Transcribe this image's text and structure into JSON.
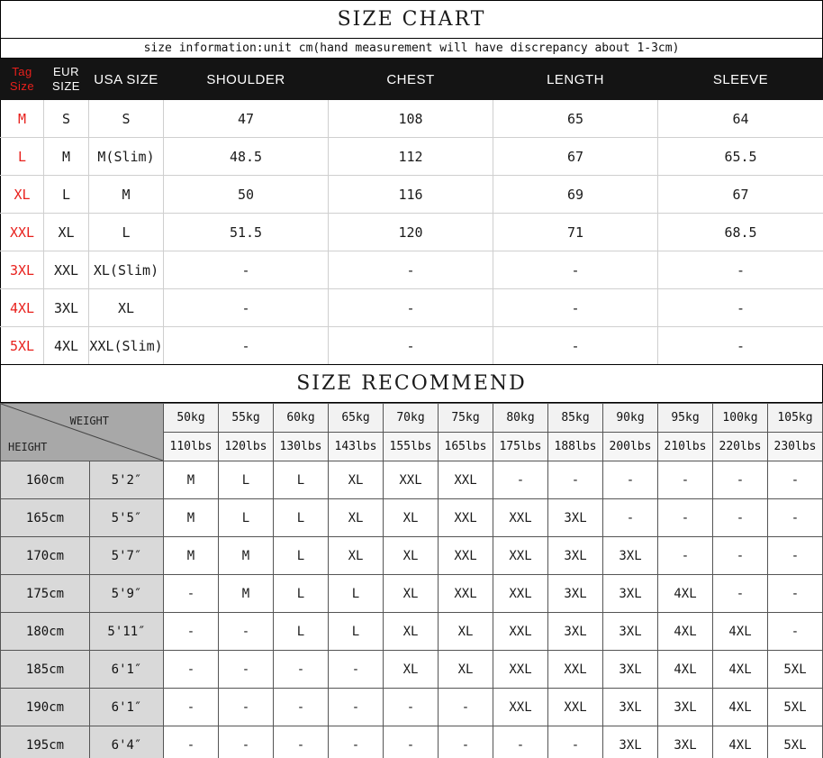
{
  "size_chart": {
    "title": "SIZE CHART",
    "subtitle": "size information:unit cm(hand measurement will have discrepancy about 1-3cm)",
    "headers": {
      "tag_size_line1": "Tag",
      "tag_size_line2": "Size",
      "eur_line1": "EUR",
      "eur_line2": "SIZE",
      "usa": "USA SIZE",
      "shoulder": "SHOULDER",
      "chest": "CHEST",
      "length": "LENGTH",
      "sleeve": "SLEEVE"
    },
    "rows": [
      {
        "tag": "M",
        "eur": "S",
        "usa": "S",
        "shoulder": "47",
        "chest": "108",
        "length": "65",
        "sleeve": "64"
      },
      {
        "tag": "L",
        "eur": "M",
        "usa": "M(Slim)",
        "shoulder": "48.5",
        "chest": "112",
        "length": "67",
        "sleeve": "65.5"
      },
      {
        "tag": "XL",
        "eur": "L",
        "usa": "M",
        "shoulder": "50",
        "chest": "116",
        "length": "69",
        "sleeve": "67"
      },
      {
        "tag": "XXL",
        "eur": "XL",
        "usa": "L",
        "shoulder": "51.5",
        "chest": "120",
        "length": "71",
        "sleeve": "68.5"
      },
      {
        "tag": "3XL",
        "eur": "XXL",
        "usa": "XL(Slim)",
        "shoulder": "-",
        "chest": "-",
        "length": "-",
        "sleeve": "-"
      },
      {
        "tag": "4XL",
        "eur": "3XL",
        "usa": "XL",
        "shoulder": "-",
        "chest": "-",
        "length": "-",
        "sleeve": "-"
      },
      {
        "tag": "5XL",
        "eur": "4XL",
        "usa": "XXL(Slim)",
        "shoulder": "-",
        "chest": "-",
        "length": "-",
        "sleeve": "-"
      }
    ]
  },
  "size_recommend": {
    "title": "SIZE RECOMMEND",
    "axis_weight_label": "WEIGHT",
    "axis_height_label": "HEIGHT",
    "weights_kg": [
      "50kg",
      "55kg",
      "60kg",
      "65kg",
      "70kg",
      "75kg",
      "80kg",
      "85kg",
      "90kg",
      "95kg",
      "100kg",
      "105kg"
    ],
    "weights_lbs": [
      "110lbs",
      "120lbs",
      "130lbs",
      "143lbs",
      "155lbs",
      "165lbs",
      "175lbs",
      "188lbs",
      "200lbs",
      "210lbs",
      "220lbs",
      "230lbs"
    ],
    "heights_cm": [
      "160cm",
      "165cm",
      "170cm",
      "175cm",
      "180cm",
      "185cm",
      "190cm",
      "195cm"
    ],
    "heights_ft": [
      "5'2″",
      "5'5″",
      "5'7″",
      "5'9″",
      "5'11″",
      "6'1″",
      "6'1″",
      "6'4″"
    ],
    "grid": [
      [
        "M",
        "L",
        "L",
        "XL",
        "XXL",
        "XXL",
        "-",
        "-",
        "-",
        "-",
        "-",
        "-"
      ],
      [
        "M",
        "L",
        "L",
        "XL",
        "XL",
        "XXL",
        "XXL",
        "3XL",
        "-",
        "-",
        "-",
        "-"
      ],
      [
        "M",
        "M",
        "L",
        "XL",
        "XL",
        "XXL",
        "XXL",
        "3XL",
        "3XL",
        "-",
        "-",
        "-"
      ],
      [
        "-",
        "M",
        "L",
        "L",
        "XL",
        "XXL",
        "XXL",
        "3XL",
        "3XL",
        "4XL",
        "-",
        "-"
      ],
      [
        "-",
        "-",
        "L",
        "L",
        "XL",
        "XL",
        "XXL",
        "3XL",
        "3XL",
        "4XL",
        "4XL",
        "-"
      ],
      [
        "-",
        "-",
        "-",
        "-",
        "XL",
        "XL",
        "XXL",
        "XXL",
        "3XL",
        "4XL",
        "4XL",
        "5XL"
      ],
      [
        "-",
        "-",
        "-",
        "-",
        "-",
        "-",
        "XXL",
        "XXL",
        "3XL",
        "3XL",
        "4XL",
        "5XL"
      ],
      [
        "-",
        "-",
        "-",
        "-",
        "-",
        "-",
        "-",
        "-",
        "3XL",
        "3XL",
        "4XL",
        "5XL"
      ]
    ]
  },
  "colors": {
    "header_bg": "#141414",
    "tag_red": "#e8201c",
    "M": "#d9eaf7",
    "L": "#a8cde8",
    "XL": "#7eb7e0",
    "XXL": "#4a94d4",
    "3XL": "#2a7ac4",
    "4XL": "#245a8c",
    "5XL": "#1a4268",
    "axis_header_bg": "#a8a8a8",
    "height_col_bg": "#d9d9d9"
  }
}
